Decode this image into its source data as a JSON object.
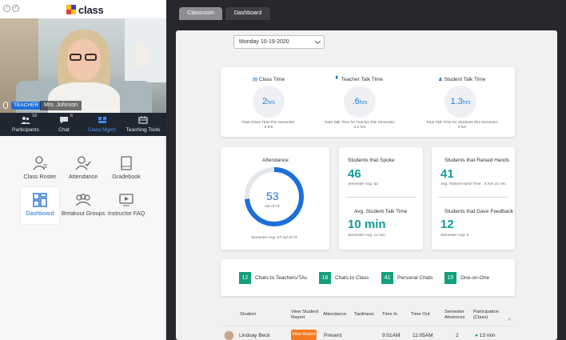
{
  "app": {
    "logo_text": "class"
  },
  "video": {
    "role_badge": "TEACHER",
    "participant_name": "Mrs. Johnson"
  },
  "toolbar": [
    {
      "label": "Participants",
      "count": "18",
      "icon": "participants-icon"
    },
    {
      "label": "Chat",
      "count": "6",
      "icon": "chat-icon"
    },
    {
      "label": "Class Mgmt.",
      "count": "",
      "icon": "class-mgmt-icon"
    },
    {
      "label": "Teaching Tools",
      "count": "",
      "icon": "teaching-tools-icon"
    }
  ],
  "tiles": [
    {
      "label": "Class Roster",
      "icon": "class-roster-icon"
    },
    {
      "label": "Attendance",
      "icon": "attendance-icon"
    },
    {
      "label": "Gradebook",
      "icon": "gradebook-icon"
    },
    {
      "label": "Dashboard",
      "icon": "dashboard-icon",
      "active": true
    },
    {
      "label": "Breakout Groups",
      "icon": "breakout-groups-icon"
    },
    {
      "label": "Instructor FAQ",
      "icon": "instructor-faq-icon"
    }
  ],
  "tabs": [
    {
      "label": "Classroom"
    },
    {
      "label": "Dashboard"
    }
  ],
  "date_select": {
    "value": "Monday 10-19-2020"
  },
  "stats": {
    "class_time": {
      "title": "Class Time",
      "value": "2",
      "unit": "hrs",
      "sub1": "Total Class Time this Semester:",
      "sub2": "8 hrs"
    },
    "teacher_talk": {
      "title": "Teacher Talk Time",
      "value": ".6",
      "unit": "hrs",
      "sub1": "Total Talk Time for Teacher this Semester:",
      "sub2": "3.2 hrs"
    },
    "student_talk": {
      "title": "Student Talk Time",
      "value": "1.3",
      "unit": "hrs",
      "sub1": "Total Talk Time for Students this Semester:",
      "sub2": "4 hrs"
    }
  },
  "attendance": {
    "title": "Attendance",
    "value": "53",
    "of_label": "out of 72",
    "present": 53,
    "total": 72,
    "avg": "Semester Avg: 67 out of 72"
  },
  "spoke": {
    "title": "Students that Spoke",
    "value": "46",
    "avg": "Semester Avg: 52"
  },
  "talk_time": {
    "title": "Avg. Student Talk Time",
    "value": "10 min",
    "avg": "Semester Avg: 12 min"
  },
  "raised": {
    "title": "Students that Raised Hands",
    "value": "41",
    "avg": "Avg. Raised Hand Time : 3 min 21 sec"
  },
  "feedback": {
    "title": "Students that Gave Feedback",
    "value": "12",
    "avg": "Semester Avg: 9"
  },
  "chips": [
    {
      "count": "12",
      "label": "Chats to Teachers/TAs"
    },
    {
      "count": "18",
      "label": "Chats to Class"
    },
    {
      "count": "41",
      "label": "Personal Chats"
    },
    {
      "count": "15",
      "label": "One-on-One"
    }
  ],
  "table": {
    "headers": [
      "Student",
      "View Student Report",
      "Attendance",
      "Tardiness",
      "Time In",
      "Time Out",
      "Semester Absences",
      "Participation (Class)"
    ],
    "rows": [
      {
        "student": "Lindsay Beck",
        "report_button": "View Report",
        "attendance": "Present",
        "tardiness": "",
        "time_in": "9:01AM",
        "time_out": "11:05AM",
        "absences": "2",
        "participation": "13 min"
      }
    ],
    "more": "»"
  },
  "colors": {
    "accent": "#1d7fd6",
    "teal": "#109d9d",
    "green": "#14a07c",
    "orange": "#f47b20",
    "toolbar": "#1f2631"
  }
}
